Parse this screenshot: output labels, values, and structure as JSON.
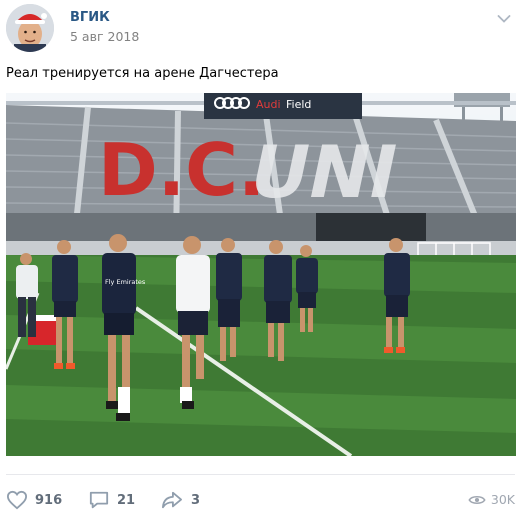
{
  "post": {
    "author": "ВГИК",
    "date": "5 авг 2018",
    "text": "Реал тренируется на арене Дагчестера",
    "photo": {
      "banner_brand": "Audi",
      "banner_venue": "Field",
      "seat_letters": "D.C. UNI",
      "player_kit_text": "Fly Emirates"
    },
    "actions": {
      "likes": "916",
      "comments": "21",
      "shares": "3",
      "views": "30K"
    }
  },
  "colors": {
    "link": "#2a5885",
    "meta": "#828282",
    "action": "#626d7a",
    "grass": "#3f7a34",
    "seat_red": "#c8312e"
  }
}
